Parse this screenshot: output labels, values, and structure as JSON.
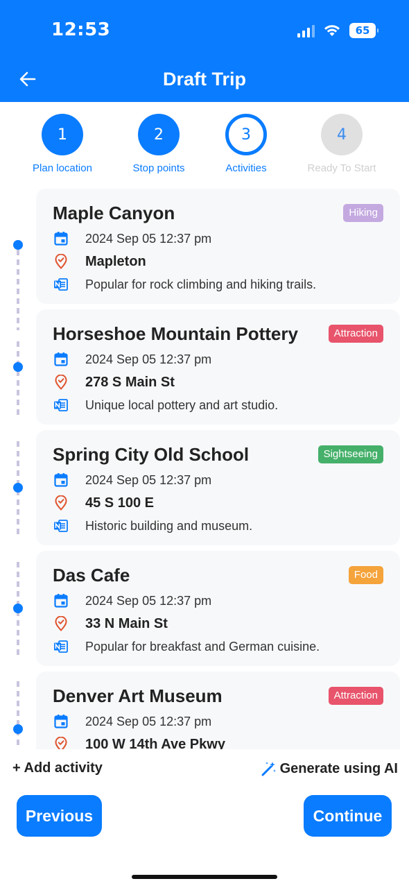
{
  "status_bar": {
    "time": "12:53",
    "battery": "65"
  },
  "header": {
    "title": "Draft Trip"
  },
  "stepper": [
    {
      "number": "1",
      "label": "Plan location",
      "state": "done"
    },
    {
      "number": "2",
      "label": "Stop points",
      "state": "done"
    },
    {
      "number": "3",
      "label": "Activities",
      "state": "current"
    },
    {
      "number": "4",
      "label": "Ready To Start",
      "state": "todo"
    }
  ],
  "activities": [
    {
      "title": "Maple Canyon",
      "badge": "Hiking",
      "badge_color": "#c4a9e0",
      "datetime": "2024 Sep 05 12:37 pm",
      "location": "Mapleton",
      "note": "Popular for rock climbing and hiking trails."
    },
    {
      "title": "Horseshoe Mountain Pottery",
      "badge": "Attraction",
      "badge_color": "#e8546b",
      "datetime": "2024 Sep 05 12:37 pm",
      "location": "278 S Main St",
      "note": "Unique local pottery and art studio."
    },
    {
      "title": "Spring City Old School",
      "badge": "Sightseeing",
      "badge_color": "#45b06a",
      "datetime": "2024 Sep 05 12:37 pm",
      "location": "45 S 100 E",
      "note": "Historic building and museum."
    },
    {
      "title": "Das Cafe",
      "badge": "Food",
      "badge_color": "#f5a33b",
      "datetime": "2024 Sep 05 12:37 pm",
      "location": "33 N Main St",
      "note": "Popular for breakfast and German cuisine."
    },
    {
      "title": "Denver Art Museum",
      "badge": "Attraction",
      "badge_color": "#e8546b",
      "datetime": "2024 Sep 05 12:37 pm",
      "location": "100 W 14th Ave Pkwy",
      "note": ""
    }
  ],
  "actions": {
    "add_activity": "+ Add activity",
    "generate_ai": "Generate using AI"
  },
  "buttons": {
    "previous": "Previous",
    "continue": "Continue"
  },
  "colors": {
    "primary": "#0a7cff",
    "location_icon": "#e0552f"
  }
}
